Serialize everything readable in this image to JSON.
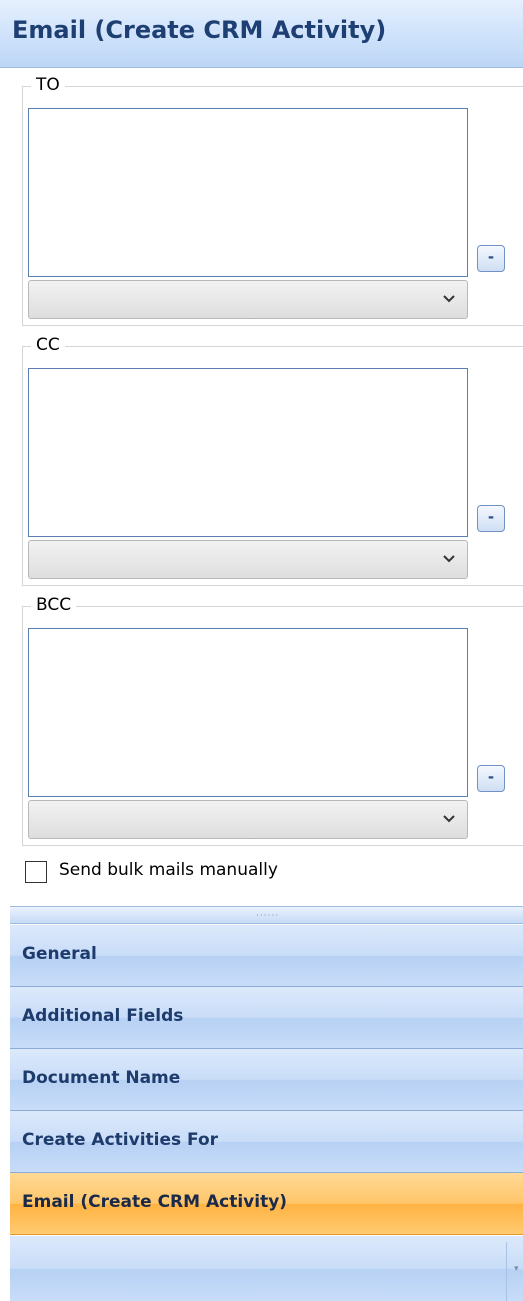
{
  "header": {
    "title": "Email (Create CRM Activity)"
  },
  "groups": {
    "to": {
      "legend": "TO",
      "remove_label": "-"
    },
    "cc": {
      "legend": "CC",
      "remove_label": "-"
    },
    "bcc": {
      "legend": "BCC",
      "remove_label": "-"
    }
  },
  "bulk_option": {
    "label": "Send bulk mails manually",
    "checked": false
  },
  "navigation": {
    "items": [
      {
        "label": "General",
        "active": false
      },
      {
        "label": "Additional Fields",
        "active": false
      },
      {
        "label": "Document Name",
        "active": false
      },
      {
        "label": "Create Activities For",
        "active": false
      },
      {
        "label": "Email (Create CRM Activity)",
        "active": true
      }
    ]
  },
  "colors": {
    "header_text": "#1e3f72",
    "nav_text": "#1d3b6c",
    "active_nav": "#ffb343",
    "listbox_border": "#5c7fb1"
  }
}
